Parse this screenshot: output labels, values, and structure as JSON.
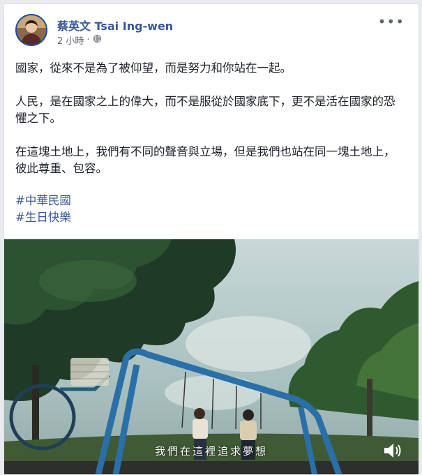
{
  "post": {
    "author_name": "蔡英文 Tsai Ing-wen",
    "timestamp": "2 小時",
    "privacy_icon": "globe-icon",
    "more_icon": "more-options-icon",
    "paragraphs": [
      "國家，從來不是為了被仰望，而是努力和你站在一起。",
      "人民，是在國家之上的偉大，而不是服從於國家底下，更不是活在國家的恐懼之下。",
      "在這塊土地上，我們有不同的聲音與立場，但是我們也站在同一塊土地上，彼此尊重、包容。"
    ],
    "hashtags": [
      "#中華民國",
      "#生日快樂"
    ]
  },
  "video": {
    "subtitle": "我們在這裡追求夢想",
    "sound_icon": "speaker-icon"
  },
  "colors": {
    "link": "#365899",
    "text": "#1d2129",
    "meta": "#616770",
    "background": "#e9ebee"
  }
}
